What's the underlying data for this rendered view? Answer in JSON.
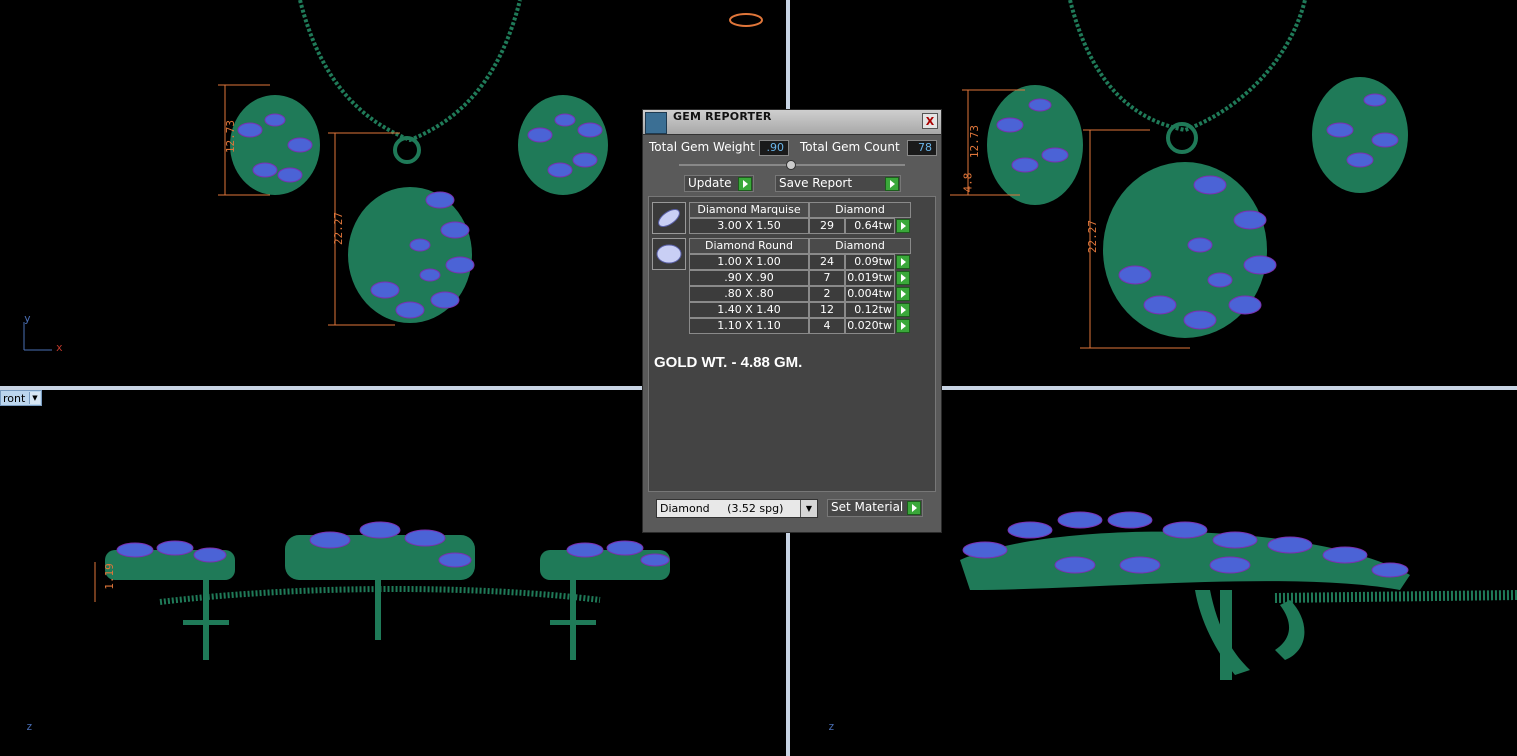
{
  "viewport": {
    "view_label": "ront",
    "axes_top_left": {
      "y": "y",
      "x": "x"
    },
    "axes_bottom": {
      "z": "z"
    },
    "dimensions_top_left": [
      "12.73",
      "22.27"
    ],
    "dimensions_top_right": [
      "12.73",
      "4.8",
      "22.27"
    ],
    "dimension_bottom_left": "1.19"
  },
  "colors": {
    "background": "#000000",
    "metal": "#1f7a58",
    "gem_marquise": "#4b63d6",
    "gem_accent": "#7b2fb0",
    "dimension": "#e0763a",
    "splitter": "#c8d4e4"
  },
  "dialog": {
    "title": "GEM REPORTER",
    "close_label": "X",
    "total_gem_weight_label": "Total Gem Weight",
    "total_gem_weight_value": ".90",
    "total_gem_count_label": "Total Gem Count",
    "total_gem_count_value": "78",
    "update_label": "Update",
    "save_report_label": "Save Report",
    "groups": [
      {
        "shape": "Diamond Marquise",
        "material": "Diamond",
        "rows": [
          {
            "size": "3.00 X 1.50",
            "count": "29",
            "weight": "0.64tw"
          }
        ]
      },
      {
        "shape": "Diamond Round",
        "material": "Diamond",
        "rows": [
          {
            "size": "1.00 X 1.00",
            "count": "24",
            "weight": "0.09tw"
          },
          {
            "size": ".90 X .90",
            "count": "7",
            "weight": "0.019tw"
          },
          {
            "size": ".80 X .80",
            "count": "2",
            "weight": "0.004tw"
          },
          {
            "size": "1.40 X 1.40",
            "count": "12",
            "weight": "0.12tw"
          },
          {
            "size": "1.10 X 1.10",
            "count": "4",
            "weight": "0.020tw"
          }
        ]
      }
    ],
    "note": "GOLD WT. - 4.88 GM.",
    "material_select_value": "Diamond     (3.52 spg)",
    "set_material_label": "Set Material"
  }
}
